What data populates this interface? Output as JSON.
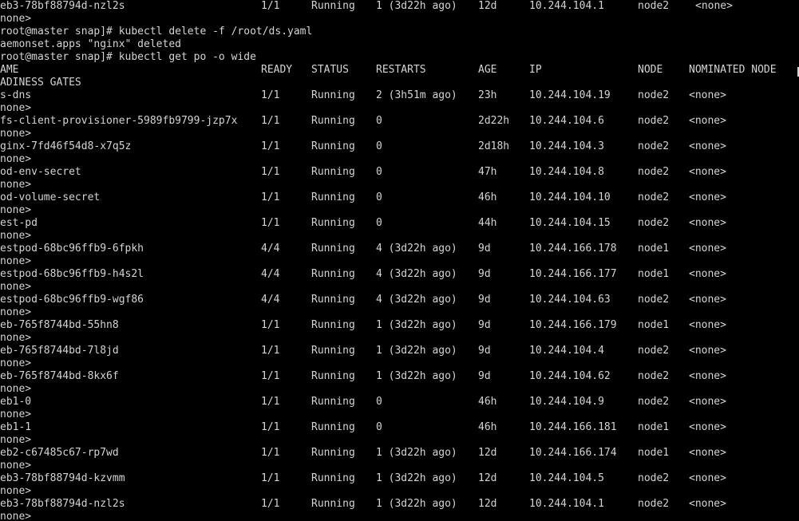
{
  "colors": {
    "background": "#000000",
    "text": "#d4d4d4"
  },
  "top_row": {
    "name": "eb3-78bf88794d-nzl2s",
    "ready": "1/1",
    "status": "Running",
    "restarts": "1 (3d22h ago)",
    "age": "12d",
    "ip": "10.244.104.1",
    "node": "node2",
    "nominated": "<none>",
    "gates": "none>"
  },
  "commands": [
    "root@master snap]# kubectl delete -f /root/ds.yaml",
    "aemonset.apps \"nginx\" deleted",
    "root@master snap]# kubectl get po -o wide"
  ],
  "headers": {
    "name": "AME",
    "ready": "READY",
    "status": "STATUS",
    "restarts": "RESTARTS",
    "age": "AGE",
    "ip": "IP",
    "node": "NODE",
    "nominated": "NOMINATED NODE",
    "gates": "ADINESS GATES"
  },
  "rows": [
    {
      "name": "s-dns",
      "ready": "1/1",
      "status": "Running",
      "restarts": "2 (3h51m ago)",
      "age": "23h",
      "ip": "10.244.104.19",
      "node": "node2",
      "nominated": "<none>",
      "gates": "none>"
    },
    {
      "name": "fs-client-provisioner-5989fb9799-jzp7x",
      "ready": "1/1",
      "status": "Running",
      "restarts": "0",
      "age": "2d22h",
      "ip": "10.244.104.6",
      "node": "node2",
      "nominated": "<none>",
      "gates": "none>"
    },
    {
      "name": "ginx-7fd46f54d8-x7q5z",
      "ready": "1/1",
      "status": "Running",
      "restarts": "0",
      "age": "2d18h",
      "ip": "10.244.104.3",
      "node": "node2",
      "nominated": "<none>",
      "gates": "none>"
    },
    {
      "name": "od-env-secret",
      "ready": "1/1",
      "status": "Running",
      "restarts": "0",
      "age": "47h",
      "ip": "10.244.104.8",
      "node": "node2",
      "nominated": "<none>",
      "gates": "none>"
    },
    {
      "name": "od-volume-secret",
      "ready": "1/1",
      "status": "Running",
      "restarts": "0",
      "age": "46h",
      "ip": "10.244.104.10",
      "node": "node2",
      "nominated": "<none>",
      "gates": "none>"
    },
    {
      "name": "est-pd",
      "ready": "1/1",
      "status": "Running",
      "restarts": "0",
      "age": "44h",
      "ip": "10.244.104.15",
      "node": "node2",
      "nominated": "<none>",
      "gates": "none>"
    },
    {
      "name": "estpod-68bc96ffb9-6fpkh",
      "ready": "4/4",
      "status": "Running",
      "restarts": "4 (3d22h ago)",
      "age": "9d",
      "ip": "10.244.166.178",
      "node": "node1",
      "nominated": "<none>",
      "gates": "none>"
    },
    {
      "name": "estpod-68bc96ffb9-h4s2l",
      "ready": "4/4",
      "status": "Running",
      "restarts": "4 (3d22h ago)",
      "age": "9d",
      "ip": "10.244.166.177",
      "node": "node1",
      "nominated": "<none>",
      "gates": "none>"
    },
    {
      "name": "estpod-68bc96ffb9-wgf86",
      "ready": "4/4",
      "status": "Running",
      "restarts": "4 (3d22h ago)",
      "age": "9d",
      "ip": "10.244.104.63",
      "node": "node2",
      "nominated": "<none>",
      "gates": "none>"
    },
    {
      "name": "eb-765f8744bd-55hn8",
      "ready": "1/1",
      "status": "Running",
      "restarts": "1 (3d22h ago)",
      "age": "9d",
      "ip": "10.244.166.179",
      "node": "node1",
      "nominated": "<none>",
      "gates": "none>"
    },
    {
      "name": "eb-765f8744bd-7l8jd",
      "ready": "1/1",
      "status": "Running",
      "restarts": "1 (3d22h ago)",
      "age": "9d",
      "ip": "10.244.104.4",
      "node": "node2",
      "nominated": "<none>",
      "gates": "none>"
    },
    {
      "name": "eb-765f8744bd-8kx6f",
      "ready": "1/1",
      "status": "Running",
      "restarts": "1 (3d22h ago)",
      "age": "9d",
      "ip": "10.244.104.62",
      "node": "node2",
      "nominated": "<none>",
      "gates": "none>"
    },
    {
      "name": "eb1-0",
      "ready": "1/1",
      "status": "Running",
      "restarts": "0",
      "age": "46h",
      "ip": "10.244.104.9",
      "node": "node2",
      "nominated": "<none>",
      "gates": "none>"
    },
    {
      "name": "eb1-1",
      "ready": "1/1",
      "status": "Running",
      "restarts": "0",
      "age": "46h",
      "ip": "10.244.166.181",
      "node": "node1",
      "nominated": "<none>",
      "gates": "none>"
    },
    {
      "name": "eb2-c67485c67-rp7wd",
      "ready": "1/1",
      "status": "Running",
      "restarts": "1 (3d22h ago)",
      "age": "12d",
      "ip": "10.244.166.174",
      "node": "node1",
      "nominated": "<none>",
      "gates": "none>"
    },
    {
      "name": "eb3-78bf88794d-kzvmm",
      "ready": "1/1",
      "status": "Running",
      "restarts": "1 (3d22h ago)",
      "age": "12d",
      "ip": "10.244.104.5",
      "node": "node2",
      "nominated": "<none>",
      "gates": "none>"
    },
    {
      "name": "eb3-78bf88794d-nzl2s",
      "ready": "1/1",
      "status": "Running",
      "restarts": "1 (3d22h ago)",
      "age": "12d",
      "ip": "10.244.104.1",
      "node": "node2",
      "nominated": "<none>",
      "gates": "none>"
    }
  ]
}
